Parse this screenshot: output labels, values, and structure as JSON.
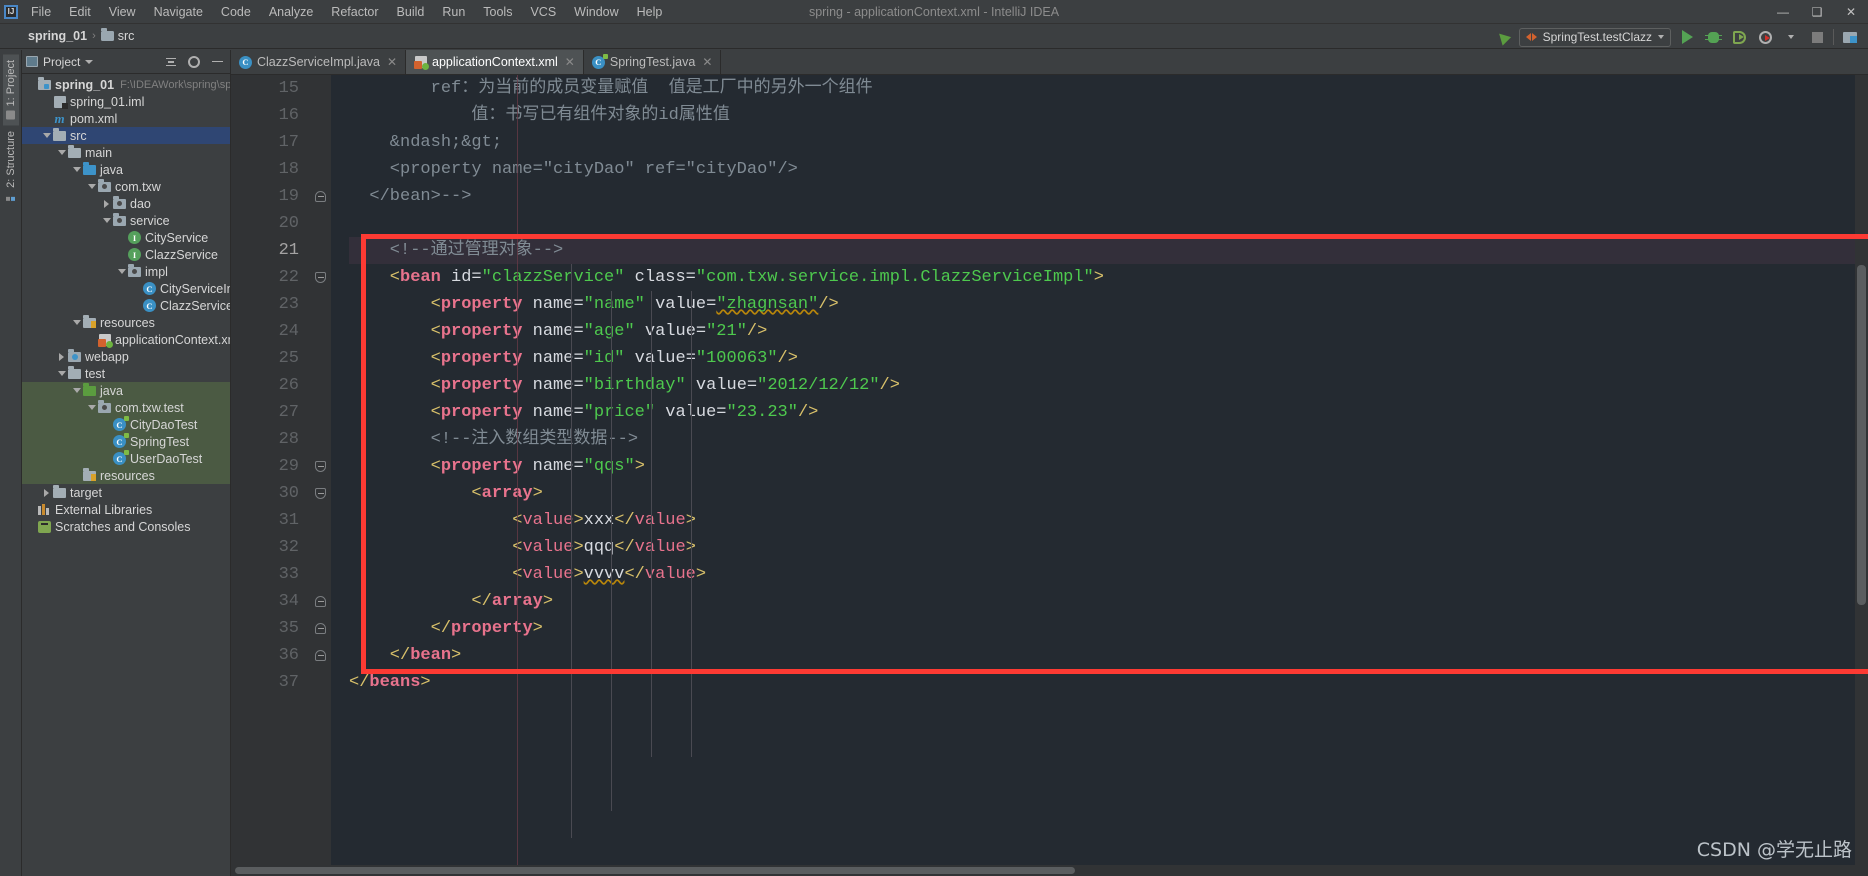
{
  "window": {
    "title": "spring - applicationContext.xml - IntelliJ IDEA",
    "logo_text": "IJ",
    "minimize": "—",
    "maximize": "❑",
    "close": "✕"
  },
  "menu": [
    {
      "label": "File"
    },
    {
      "label": "Edit"
    },
    {
      "label": "View"
    },
    {
      "label": "Navigate"
    },
    {
      "label": "Code"
    },
    {
      "label": "Analyze"
    },
    {
      "label": "Refactor"
    },
    {
      "label": "Build"
    },
    {
      "label": "Run"
    },
    {
      "label": "Tools"
    },
    {
      "label": "VCS"
    },
    {
      "label": "Window"
    },
    {
      "label": "Help"
    }
  ],
  "breadcrumb": {
    "project": "spring_01",
    "separator": "›",
    "node": "src"
  },
  "toolbar": {
    "run_config": "SpringTest.testClazz",
    "icons": [
      "hammer-icon",
      "run-icon",
      "debug-icon",
      "coverage-icon",
      "profile-icon",
      "stop-icon",
      "search-everywhere-icon"
    ]
  },
  "left_strip": {
    "project_tab": "1: Project",
    "structure_tab": "2: Structure"
  },
  "project_panel": {
    "title": "Project",
    "tree": [
      {
        "label": "spring_01",
        "path": "F:\\IDEAWork\\spring\\spring_",
        "icon": "module-icon",
        "indent": 0,
        "twist": "none",
        "bold": true,
        "state": "normal"
      },
      {
        "label": "spring_01.iml",
        "path": "",
        "icon": "iml-icon",
        "indent": 1,
        "twist": "none",
        "bold": false,
        "state": "normal"
      },
      {
        "label": "pom.xml",
        "path": "",
        "icon": "maven-icon",
        "indent": 1,
        "twist": "none",
        "bold": false,
        "state": "normal"
      },
      {
        "label": "src",
        "path": "",
        "icon": "folder-icon",
        "indent": 1,
        "twist": "down",
        "bold": false,
        "state": "selected"
      },
      {
        "label": "main",
        "path": "",
        "icon": "folder-icon",
        "indent": 2,
        "twist": "down",
        "bold": false,
        "state": "normal"
      },
      {
        "label": "java",
        "path": "",
        "icon": "source-folder-icon",
        "indent": 3,
        "twist": "down",
        "bold": false,
        "state": "normal"
      },
      {
        "label": "com.txw",
        "path": "",
        "icon": "package-icon",
        "indent": 4,
        "twist": "down",
        "bold": false,
        "state": "normal"
      },
      {
        "label": "dao",
        "path": "",
        "icon": "package-icon",
        "indent": 5,
        "twist": "right",
        "bold": false,
        "state": "normal"
      },
      {
        "label": "service",
        "path": "",
        "icon": "package-icon",
        "indent": 5,
        "twist": "down",
        "bold": false,
        "state": "normal"
      },
      {
        "label": "CityService",
        "path": "",
        "icon": "interface-icon",
        "indent": 6,
        "twist": "none",
        "bold": false,
        "state": "normal"
      },
      {
        "label": "ClazzService",
        "path": "",
        "icon": "interface-icon",
        "indent": 6,
        "twist": "none",
        "bold": false,
        "state": "normal"
      },
      {
        "label": "impl",
        "path": "",
        "icon": "package-icon",
        "indent": 6,
        "twist": "down",
        "bold": false,
        "state": "normal"
      },
      {
        "label": "CityServiceImpl",
        "path": "",
        "icon": "class-icon",
        "indent": 7,
        "twist": "none",
        "bold": false,
        "state": "normal"
      },
      {
        "label": "ClazzServiceImpl",
        "path": "",
        "icon": "class-icon",
        "indent": 7,
        "twist": "none",
        "bold": false,
        "state": "normal"
      },
      {
        "label": "resources",
        "path": "",
        "icon": "resources-folder-icon",
        "indent": 3,
        "twist": "down",
        "bold": false,
        "state": "normal"
      },
      {
        "label": "applicationContext.xml",
        "path": "",
        "icon": "spring-xml-icon",
        "indent": 4,
        "twist": "none",
        "bold": false,
        "state": "normal"
      },
      {
        "label": "webapp",
        "path": "",
        "icon": "webapp-folder-icon",
        "indent": 2,
        "twist": "right",
        "bold": false,
        "state": "normal"
      },
      {
        "label": "test",
        "path": "",
        "icon": "folder-icon",
        "indent": 2,
        "twist": "down",
        "bold": false,
        "state": "normal"
      },
      {
        "label": "java",
        "path": "",
        "icon": "test-source-folder-icon",
        "indent": 3,
        "twist": "down",
        "bold": false,
        "state": "testsrc"
      },
      {
        "label": "com.txw.test",
        "path": "",
        "icon": "package-icon",
        "indent": 4,
        "twist": "down",
        "bold": false,
        "state": "testsrc"
      },
      {
        "label": "CityDaoTest",
        "path": "",
        "icon": "test-class-icon",
        "indent": 5,
        "twist": "none",
        "bold": false,
        "state": "testsrc"
      },
      {
        "label": "SpringTest",
        "path": "",
        "icon": "test-class-icon",
        "indent": 5,
        "twist": "none",
        "bold": false,
        "state": "testsrc"
      },
      {
        "label": "UserDaoTest",
        "path": "",
        "icon": "test-class-icon",
        "indent": 5,
        "twist": "none",
        "bold": false,
        "state": "testsrc"
      },
      {
        "label": "resources",
        "path": "",
        "icon": "resources-folder-icon",
        "indent": 3,
        "twist": "none",
        "bold": false,
        "state": "testsrc"
      },
      {
        "label": "target",
        "path": "",
        "icon": "folder-icon",
        "indent": 1,
        "twist": "right",
        "bold": false,
        "state": "normal"
      },
      {
        "label": "External Libraries",
        "path": "",
        "icon": "libraries-icon",
        "indent": 0,
        "twist": "none",
        "bold": false,
        "state": "normal"
      },
      {
        "label": "Scratches and Consoles",
        "path": "",
        "icon": "scratches-icon",
        "indent": 0,
        "twist": "none",
        "bold": false,
        "state": "normal"
      }
    ]
  },
  "editor": {
    "tabs": [
      {
        "label": "ClazzServiceImpl.java",
        "icon": "java-class-icon",
        "active": false
      },
      {
        "label": "applicationContext.xml",
        "icon": "spring-xml-icon",
        "active": true
      },
      {
        "label": "SpringTest.java",
        "icon": "java-test-class-icon",
        "active": false
      }
    ],
    "first_line": 15,
    "current_line": 21,
    "lines": [
      {
        "n": 15,
        "indent": 0,
        "tokens": [
          {
            "t": "comment",
            "s": "        ref：为当前的成员变量赋值  值是工厂中的另外一个组件"
          }
        ]
      },
      {
        "n": 16,
        "indent": 0,
        "tokens": [
          {
            "t": "comment",
            "s": "            值：书写已有组件对象的id属性值"
          }
        ]
      },
      {
        "n": 17,
        "indent": 0,
        "tokens": [
          {
            "t": "comment",
            "s": "    &ndash;&gt;"
          }
        ]
      },
      {
        "n": 18,
        "indent": 0,
        "tokens": [
          {
            "t": "comment",
            "s": "    <property name=\"cityDao\" ref=\"cityDao\"/>"
          }
        ]
      },
      {
        "n": 19,
        "indent": 0,
        "tokens": [
          {
            "t": "comment",
            "s": "  </bean>-->"
          }
        ]
      },
      {
        "n": 20,
        "indent": 0,
        "tokens": []
      },
      {
        "n": 21,
        "indent": 0,
        "tokens": [
          {
            "t": "comment",
            "s": "    <!--通过管理对象-->"
          }
        ]
      },
      {
        "n": 22,
        "indent": 0,
        "tokens": [
          {
            "t": "angle",
            "s": "    <"
          },
          {
            "t": "tag",
            "s": "bean"
          },
          {
            "t": "attr",
            "s": " id="
          },
          {
            "t": "val",
            "s": "\"clazzService\""
          },
          {
            "t": "attr",
            "s": " class="
          },
          {
            "t": "val",
            "s": "\"com.txw.service.impl.ClazzServiceImpl\""
          },
          {
            "t": "angle",
            "s": ">"
          }
        ]
      },
      {
        "n": 23,
        "indent": 0,
        "tokens": [
          {
            "t": "angle",
            "s": "        <"
          },
          {
            "t": "tag",
            "s": "property"
          },
          {
            "t": "attr",
            "s": " name="
          },
          {
            "t": "val",
            "s": "\"name\""
          },
          {
            "t": "attr",
            "s": " value="
          },
          {
            "t": "val-typo",
            "s": "\"zhagnsan\""
          },
          {
            "t": "angle",
            "s": "/>"
          }
        ]
      },
      {
        "n": 24,
        "indent": 0,
        "tokens": [
          {
            "t": "angle",
            "s": "        <"
          },
          {
            "t": "tag",
            "s": "property"
          },
          {
            "t": "attr",
            "s": " name="
          },
          {
            "t": "val",
            "s": "\"age\""
          },
          {
            "t": "attr",
            "s": " value="
          },
          {
            "t": "val",
            "s": "\"21\""
          },
          {
            "t": "angle",
            "s": "/>"
          }
        ]
      },
      {
        "n": 25,
        "indent": 0,
        "tokens": [
          {
            "t": "angle",
            "s": "        <"
          },
          {
            "t": "tag",
            "s": "property"
          },
          {
            "t": "attr",
            "s": " name="
          },
          {
            "t": "val",
            "s": "\"id\""
          },
          {
            "t": "attr",
            "s": " value="
          },
          {
            "t": "val",
            "s": "\"100063\""
          },
          {
            "t": "angle",
            "s": "/>"
          }
        ]
      },
      {
        "n": 26,
        "indent": 0,
        "tokens": [
          {
            "t": "angle",
            "s": "        <"
          },
          {
            "t": "tag",
            "s": "property"
          },
          {
            "t": "attr",
            "s": " name="
          },
          {
            "t": "val",
            "s": "\"birthday\""
          },
          {
            "t": "attr",
            "s": " value="
          },
          {
            "t": "val",
            "s": "\"2012/12/12\""
          },
          {
            "t": "angle",
            "s": "/>"
          }
        ]
      },
      {
        "n": 27,
        "indent": 0,
        "tokens": [
          {
            "t": "angle",
            "s": "        <"
          },
          {
            "t": "tag",
            "s": "property"
          },
          {
            "t": "attr",
            "s": " name="
          },
          {
            "t": "val",
            "s": "\"price\""
          },
          {
            "t": "attr",
            "s": " value="
          },
          {
            "t": "val",
            "s": "\"23.23\""
          },
          {
            "t": "angle",
            "s": "/>"
          }
        ]
      },
      {
        "n": 28,
        "indent": 0,
        "tokens": [
          {
            "t": "comment",
            "s": "        <!--注入数组类型数据-->"
          }
        ]
      },
      {
        "n": 29,
        "indent": 0,
        "tokens": [
          {
            "t": "angle",
            "s": "        <"
          },
          {
            "t": "tag",
            "s": "property"
          },
          {
            "t": "attr",
            "s": " name="
          },
          {
            "t": "val",
            "s": "\"qqs\""
          },
          {
            "t": "angle",
            "s": ">"
          }
        ]
      },
      {
        "n": 30,
        "indent": 0,
        "tokens": [
          {
            "t": "angle",
            "s": "            <"
          },
          {
            "t": "tag",
            "s": "array"
          },
          {
            "t": "angle",
            "s": ">"
          }
        ]
      },
      {
        "n": 31,
        "indent": 0,
        "tokens": [
          {
            "t": "angle",
            "s": "                <"
          },
          {
            "t": "tagn",
            "s": "value"
          },
          {
            "t": "angle",
            "s": ">"
          },
          {
            "t": "text",
            "s": "xxx"
          },
          {
            "t": "angle",
            "s": "</"
          },
          {
            "t": "tagn",
            "s": "value"
          },
          {
            "t": "angle",
            "s": ">"
          }
        ]
      },
      {
        "n": 32,
        "indent": 0,
        "tokens": [
          {
            "t": "angle",
            "s": "                <"
          },
          {
            "t": "tagn",
            "s": "value"
          },
          {
            "t": "angle",
            "s": ">"
          },
          {
            "t": "text",
            "s": "qqq"
          },
          {
            "t": "angle",
            "s": "</"
          },
          {
            "t": "tagn",
            "s": "value"
          },
          {
            "t": "angle",
            "s": ">"
          }
        ]
      },
      {
        "n": 33,
        "indent": 0,
        "tokens": [
          {
            "t": "angle",
            "s": "                <"
          },
          {
            "t": "tagn",
            "s": "value"
          },
          {
            "t": "angle",
            "s": ">"
          },
          {
            "t": "text-typo",
            "s": "vvvv"
          },
          {
            "t": "angle",
            "s": "</"
          },
          {
            "t": "tagn",
            "s": "value"
          },
          {
            "t": "angle",
            "s": ">"
          }
        ]
      },
      {
        "n": 34,
        "indent": 0,
        "tokens": [
          {
            "t": "angle",
            "s": "            </"
          },
          {
            "t": "tag",
            "s": "array"
          },
          {
            "t": "angle",
            "s": ">"
          }
        ]
      },
      {
        "n": 35,
        "indent": 0,
        "tokens": [
          {
            "t": "angle",
            "s": "        </"
          },
          {
            "t": "tag",
            "s": "property"
          },
          {
            "t": "angle",
            "s": ">"
          }
        ]
      },
      {
        "n": 36,
        "indent": 0,
        "tokens": [
          {
            "t": "angle",
            "s": "    </"
          },
          {
            "t": "tag",
            "s": "bean"
          },
          {
            "t": "angle",
            "s": ">"
          }
        ]
      },
      {
        "n": 37,
        "indent": 0,
        "tokens": [
          {
            "t": "angle",
            "s": "</"
          },
          {
            "t": "tag",
            "s": "beans"
          },
          {
            "t": "angle",
            "s": ">"
          }
        ]
      }
    ]
  },
  "annotation": {
    "highlight_color": "#fd3a33",
    "note": "red-rectangle-highlight"
  },
  "watermark": "CSDN @学无止路"
}
